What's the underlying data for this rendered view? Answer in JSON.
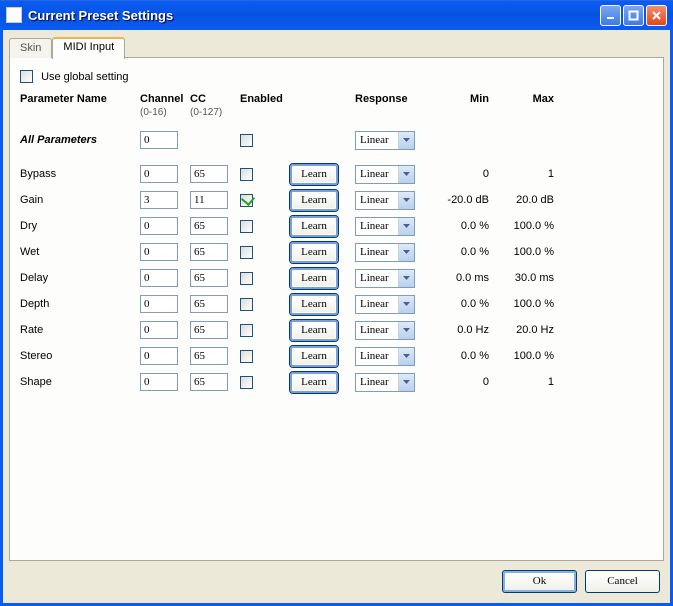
{
  "window": {
    "title": "Current Preset Settings"
  },
  "tabs": {
    "skin": "Skin",
    "midi": "MIDI Input"
  },
  "global": {
    "use_global_label": "Use global setting",
    "checked": false
  },
  "headers": {
    "param": "Parameter Name",
    "channel": "Channel",
    "channel_sub": "(0-16)",
    "cc": "CC",
    "cc_sub": "(0-127)",
    "enabled": "Enabled",
    "response": "Response",
    "min": "Min",
    "max": "Max"
  },
  "all_params_label": "All Parameters",
  "all_params_channel": "0",
  "all_params_response": "Linear",
  "learn_label": "Learn",
  "rows": [
    {
      "name": "Bypass",
      "channel": "0",
      "cc": "65",
      "enabled": false,
      "response": "Linear",
      "min": "0",
      "max": "1"
    },
    {
      "name": "Gain",
      "channel": "3",
      "cc": "11",
      "enabled": true,
      "response": "Linear",
      "min": "-20.0 dB",
      "max": "20.0 dB"
    },
    {
      "name": "Dry",
      "channel": "0",
      "cc": "65",
      "enabled": false,
      "response": "Linear",
      "min": "0.0 %",
      "max": "100.0 %"
    },
    {
      "name": "Wet",
      "channel": "0",
      "cc": "65",
      "enabled": false,
      "response": "Linear",
      "min": "0.0 %",
      "max": "100.0 %"
    },
    {
      "name": "Delay",
      "channel": "0",
      "cc": "65",
      "enabled": false,
      "response": "Linear",
      "min": "0.0 ms",
      "max": "30.0 ms"
    },
    {
      "name": "Depth",
      "channel": "0",
      "cc": "65",
      "enabled": false,
      "response": "Linear",
      "min": "0.0 %",
      "max": "100.0 %"
    },
    {
      "name": "Rate",
      "channel": "0",
      "cc": "65",
      "enabled": false,
      "response": "Linear",
      "min": "0.0 Hz",
      "max": "20.0 Hz"
    },
    {
      "name": "Stereo",
      "channel": "0",
      "cc": "65",
      "enabled": false,
      "response": "Linear",
      "min": "0.0 %",
      "max": "100.0 %"
    },
    {
      "name": "Shape",
      "channel": "0",
      "cc": "65",
      "enabled": false,
      "response": "Linear",
      "min": "0",
      "max": "1"
    }
  ],
  "buttons": {
    "ok": "Ok",
    "cancel": "Cancel"
  }
}
